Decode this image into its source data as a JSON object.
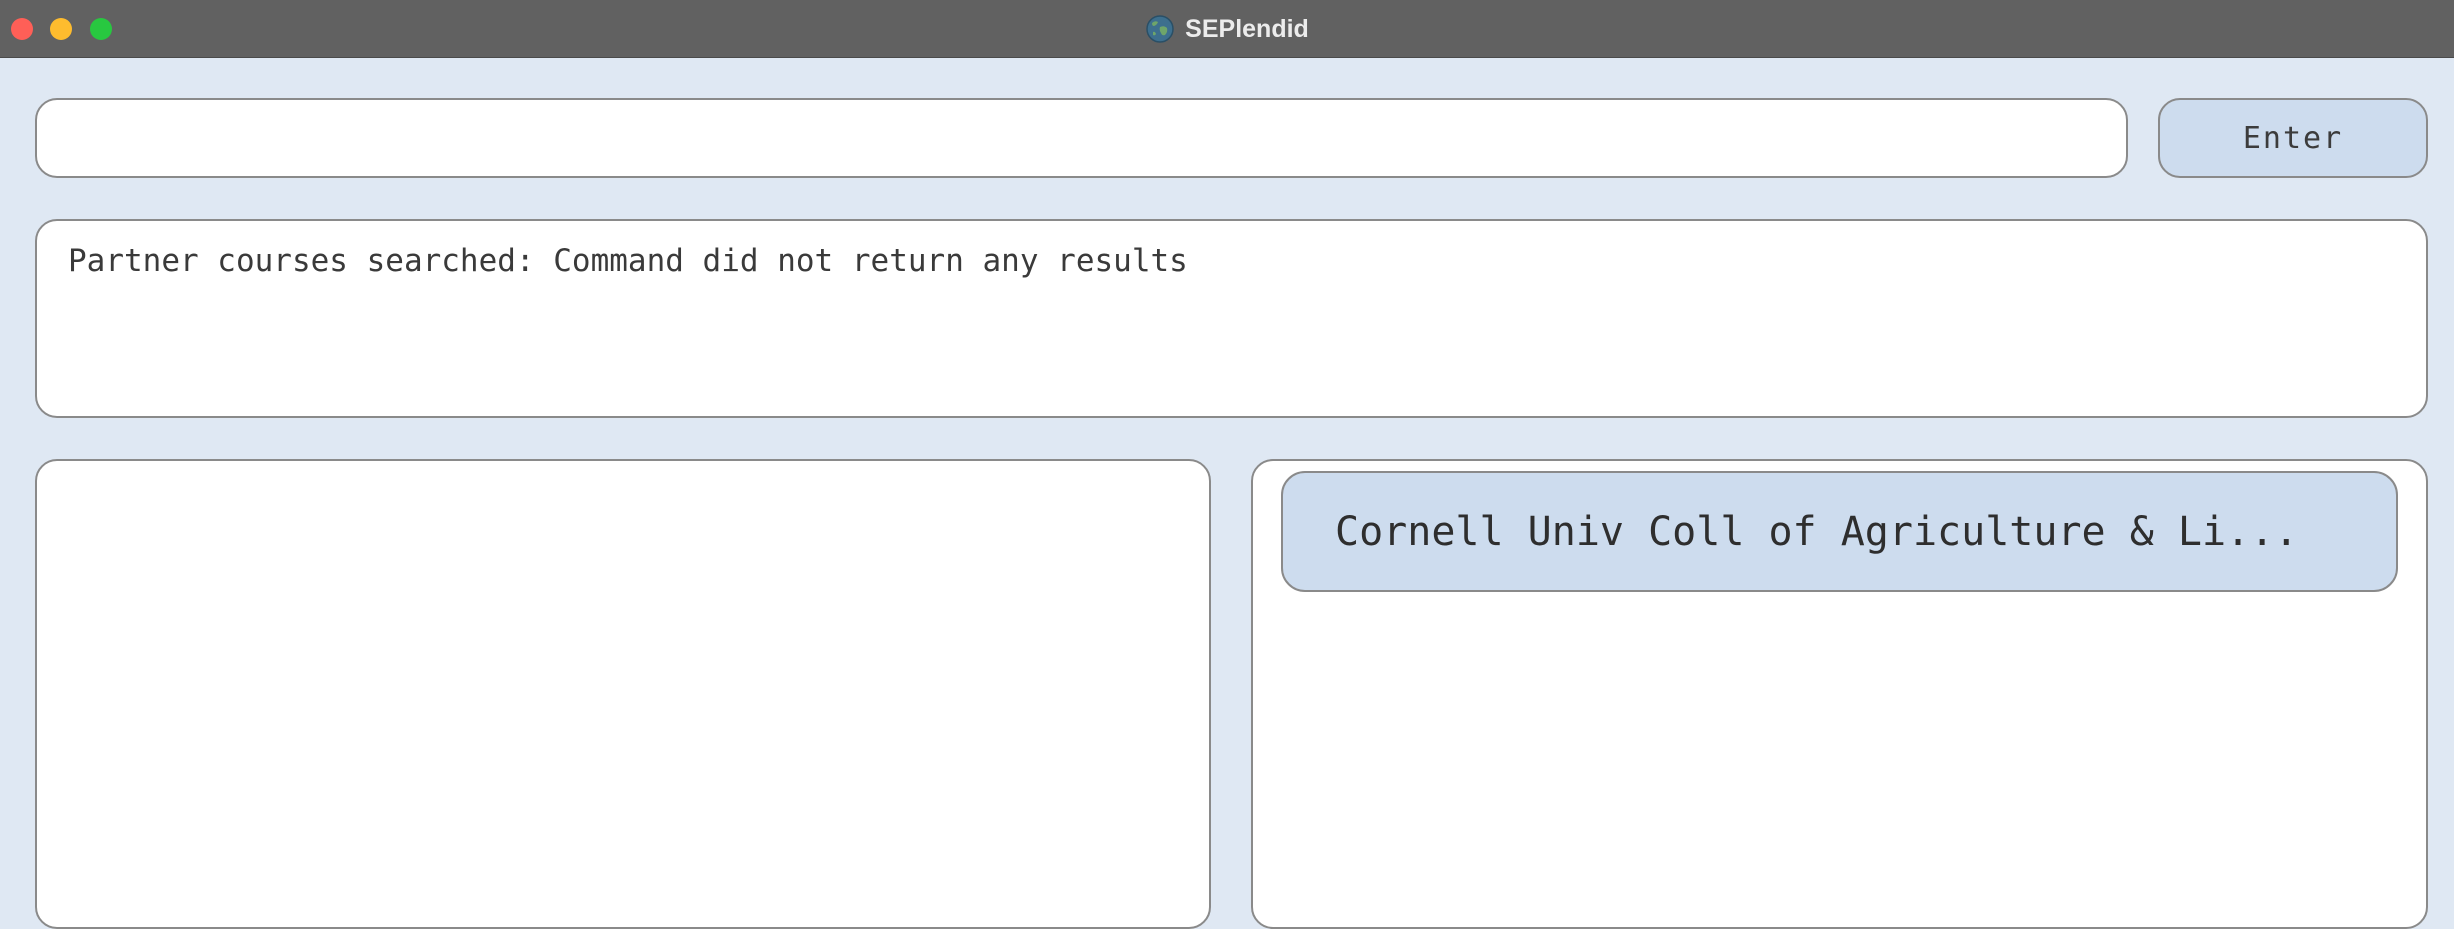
{
  "window": {
    "title": "SEPlendid",
    "app_icon": "globe-icon"
  },
  "command": {
    "value": "",
    "placeholder": "",
    "enter_label": "Enter"
  },
  "result": {
    "text": "Partner courses searched: Command did not return any results"
  },
  "universities": [
    {
      "name": "Cornell Univ Coll of Agriculture & Li..."
    }
  ],
  "colors": {
    "background": "#dfe8f3",
    "titlebar": "#616161",
    "card": "#cddcee",
    "border": "#8a8a8a"
  }
}
